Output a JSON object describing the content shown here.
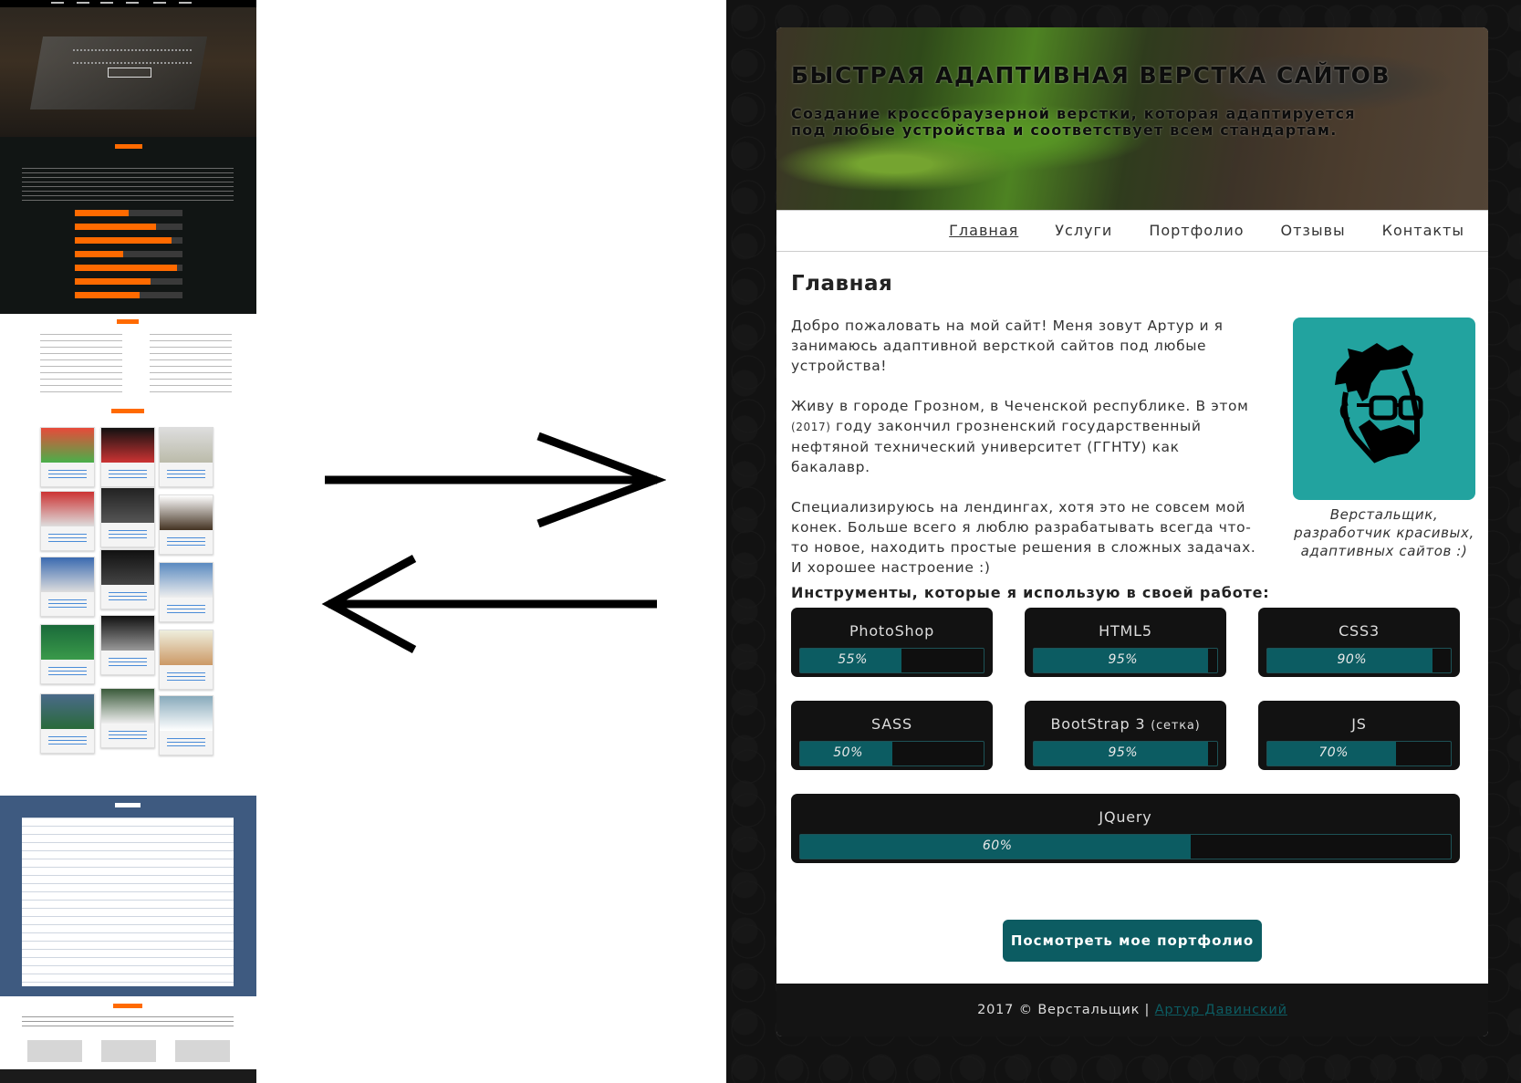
{
  "hero": {
    "title": "БЫСТРАЯ АДАПТИВНАЯ ВЕРСТКА САЙТОВ",
    "subtitle": "Создание кроссбраузерной верстки, которая адаптируется под любые устройства и соответствует всем стандартам."
  },
  "nav": {
    "items": [
      {
        "label": "Главная",
        "active": true
      },
      {
        "label": "Услуги",
        "active": false
      },
      {
        "label": "Портфолио",
        "active": false
      },
      {
        "label": "Отзывы",
        "active": false
      },
      {
        "label": "Контакты",
        "active": false
      }
    ]
  },
  "main": {
    "title": "Главная",
    "paragraphs": [
      {
        "text": "Добро пожаловать на мой сайт! Меня зовут Артур и я занимаюсь адаптивной версткой сайтов под любые устройства!"
      },
      {
        "text_before": "Живу в городе Грозном, в Чеченской республике. В этом",
        "year": "(2017)",
        "text_after": "году закончил грозненский государственный нефтяной технический университет (ГГНТУ) как бакалавр."
      },
      {
        "text": "Специализируюсь на лендингах, хотя это не совсем мой конек. Больше всего я люблю разрабатывать всегда что-то новое, находить простые решения в сложных задачах. И хорошее настроение :)"
      }
    ],
    "avatar_icon": "hipster-face-icon",
    "avatar_bg": "#22a39f",
    "caption": "Верстальщик, разработчик красивых, адаптивных сайтов :)",
    "tools_title": "Инструменты, которые я использую в своей работе:",
    "skills": [
      {
        "name": "PhotoShop",
        "note": "",
        "percent": 55,
        "label": "55%"
      },
      {
        "name": "HTML5",
        "note": "",
        "percent": 95,
        "label": "95%"
      },
      {
        "name": "CSS3",
        "note": "",
        "percent": 90,
        "label": "90%"
      },
      {
        "name": "SASS",
        "note": "",
        "percent": 50,
        "label": "50%"
      },
      {
        "name": "BootStrap 3",
        "note": "(сетка)",
        "percent": 95,
        "label": "95%"
      },
      {
        "name": "JS",
        "note": "",
        "percent": 70,
        "label": "70%"
      },
      {
        "name": "JQuery",
        "note": "",
        "percent": 60,
        "label": "60%"
      }
    ],
    "cta_label": "Посмотреть мое портфолио"
  },
  "footer": {
    "text": "2017 © Верстальщик |",
    "author": "Артур Давинский"
  },
  "colors": {
    "accent": "#0c5c62",
    "avatar": "#22a39f",
    "old_site_accent": "#ff6a00",
    "reviews_bg": "#3e5a80"
  },
  "arrows": [
    "arrow-right-icon",
    "arrow-left-icon"
  ]
}
